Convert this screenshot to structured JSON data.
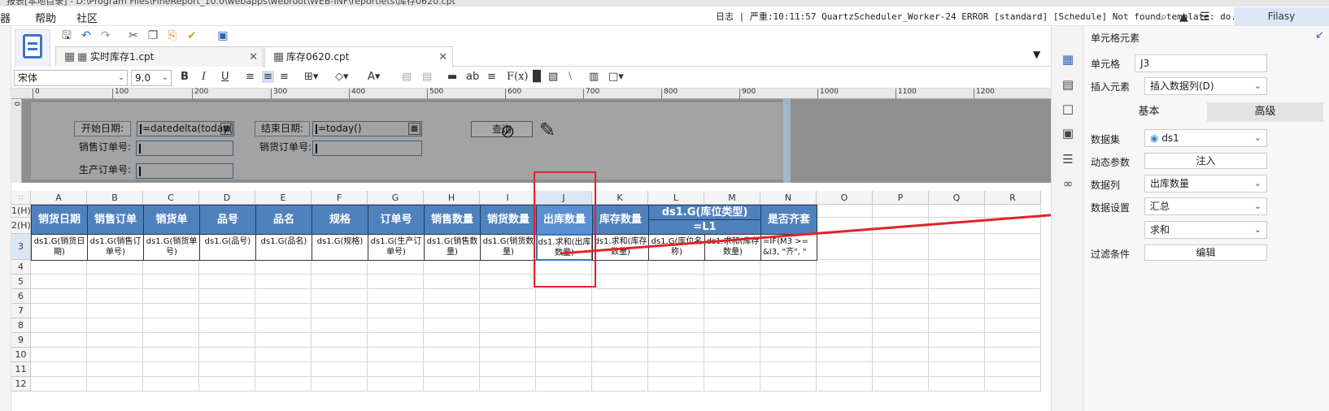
{
  "titlebar": {
    "text": "报表[本地目录] - D:\\Program Files\\FineReport_10.0\\webapps\\webroot\\WEB-INF\\reportlets\\库存0620.cpt"
  },
  "menu": {
    "items": [
      "器",
      "帮助",
      "社区"
    ]
  },
  "log": {
    "text": "日志 | 严重:10:11:57 QuartzScheduler_Worker-24 ERROR [standard] [Schedule] Not found template: do..."
  },
  "user": {
    "name": "Filasy"
  },
  "tabs": [
    {
      "label": "实时库存1.cpt"
    },
    {
      "label": "库存0620.cpt"
    }
  ],
  "font": {
    "family": "宋体",
    "size": "9.0"
  },
  "format": {
    "bold": "B",
    "italic": "I",
    "underline": "U",
    "abc": "ab",
    "fx": "F(x)"
  },
  "ruler": {
    "ticks": [
      "0",
      "100",
      "200",
      "300",
      "400",
      "500",
      "600",
      "700",
      "800",
      "900",
      "1000",
      "1100",
      "1200"
    ],
    "v": "0"
  },
  "params": {
    "start_label": "开始日期:",
    "start_value": "=datedelta(today(",
    "end_label": "结束日期:",
    "end_value": "=today()",
    "sales_label": "销售订单号:",
    "ship_label": "销货订单号:",
    "prod_label": "生产订单号:",
    "query_label": "查询"
  },
  "grid": {
    "cols": [
      "A",
      "B",
      "C",
      "D",
      "E",
      "F",
      "G",
      "H",
      "I",
      "J",
      "K",
      "L",
      "M",
      "N",
      "O",
      "P",
      "Q",
      "R"
    ],
    "rows": [
      "1(H)",
      "2(H)",
      "3",
      "4",
      "5",
      "6",
      "7",
      "8",
      "9",
      "10",
      "11",
      "12"
    ],
    "headers": [
      "销货日期",
      "销售订单",
      "销货单",
      "品号",
      "品名",
      "规格",
      "订单号",
      "销售数量",
      "销货数量",
      "出库数量",
      "库存数量",
      "是否齐套"
    ],
    "lm_header_top": "ds1.G(库位类型)",
    "lm_header_bottom": "=L1",
    "row3": [
      "ds1.G(销货日期)",
      "ds1.G(销售订单号)",
      "ds1.G(销货单号)",
      "ds1.G(品号)",
      "ds1.G(品名)",
      "ds1.G(规格)",
      "ds1.G(生产订单号)",
      "ds1.G(销售数量)",
      "ds1.G(销货数量)",
      "ds1.求和(出库数量)",
      "ds1.求和(库存数量)",
      "ds1.G(库位名称)",
      "ds1.求和(库存数量)",
      "=IF(M3 >= &I3, \"齐\", \""
    ]
  },
  "panel": {
    "title": "单元格元素",
    "cell_label": "单元格",
    "cell_value": "J3",
    "insert_label": "插入元素",
    "insert_value": "插入数据列(D)",
    "tab_basic": "基本",
    "tab_adv": "高级",
    "dataset_label": "数据集",
    "dataset_value": "ds1",
    "dyn_label": "动态参数",
    "dyn_btn": "注入",
    "col_label": "数据列",
    "col_value": "出库数量",
    "setting_label": "数据设置",
    "setting_value": "汇总",
    "agg_value": "求和",
    "filter_label": "过滤条件",
    "filter_btn": "编辑"
  },
  "colors": {
    "header_blue": "#4f81bd",
    "annotation_red": "#e0232a",
    "param_gray": "#a3a3a3"
  }
}
